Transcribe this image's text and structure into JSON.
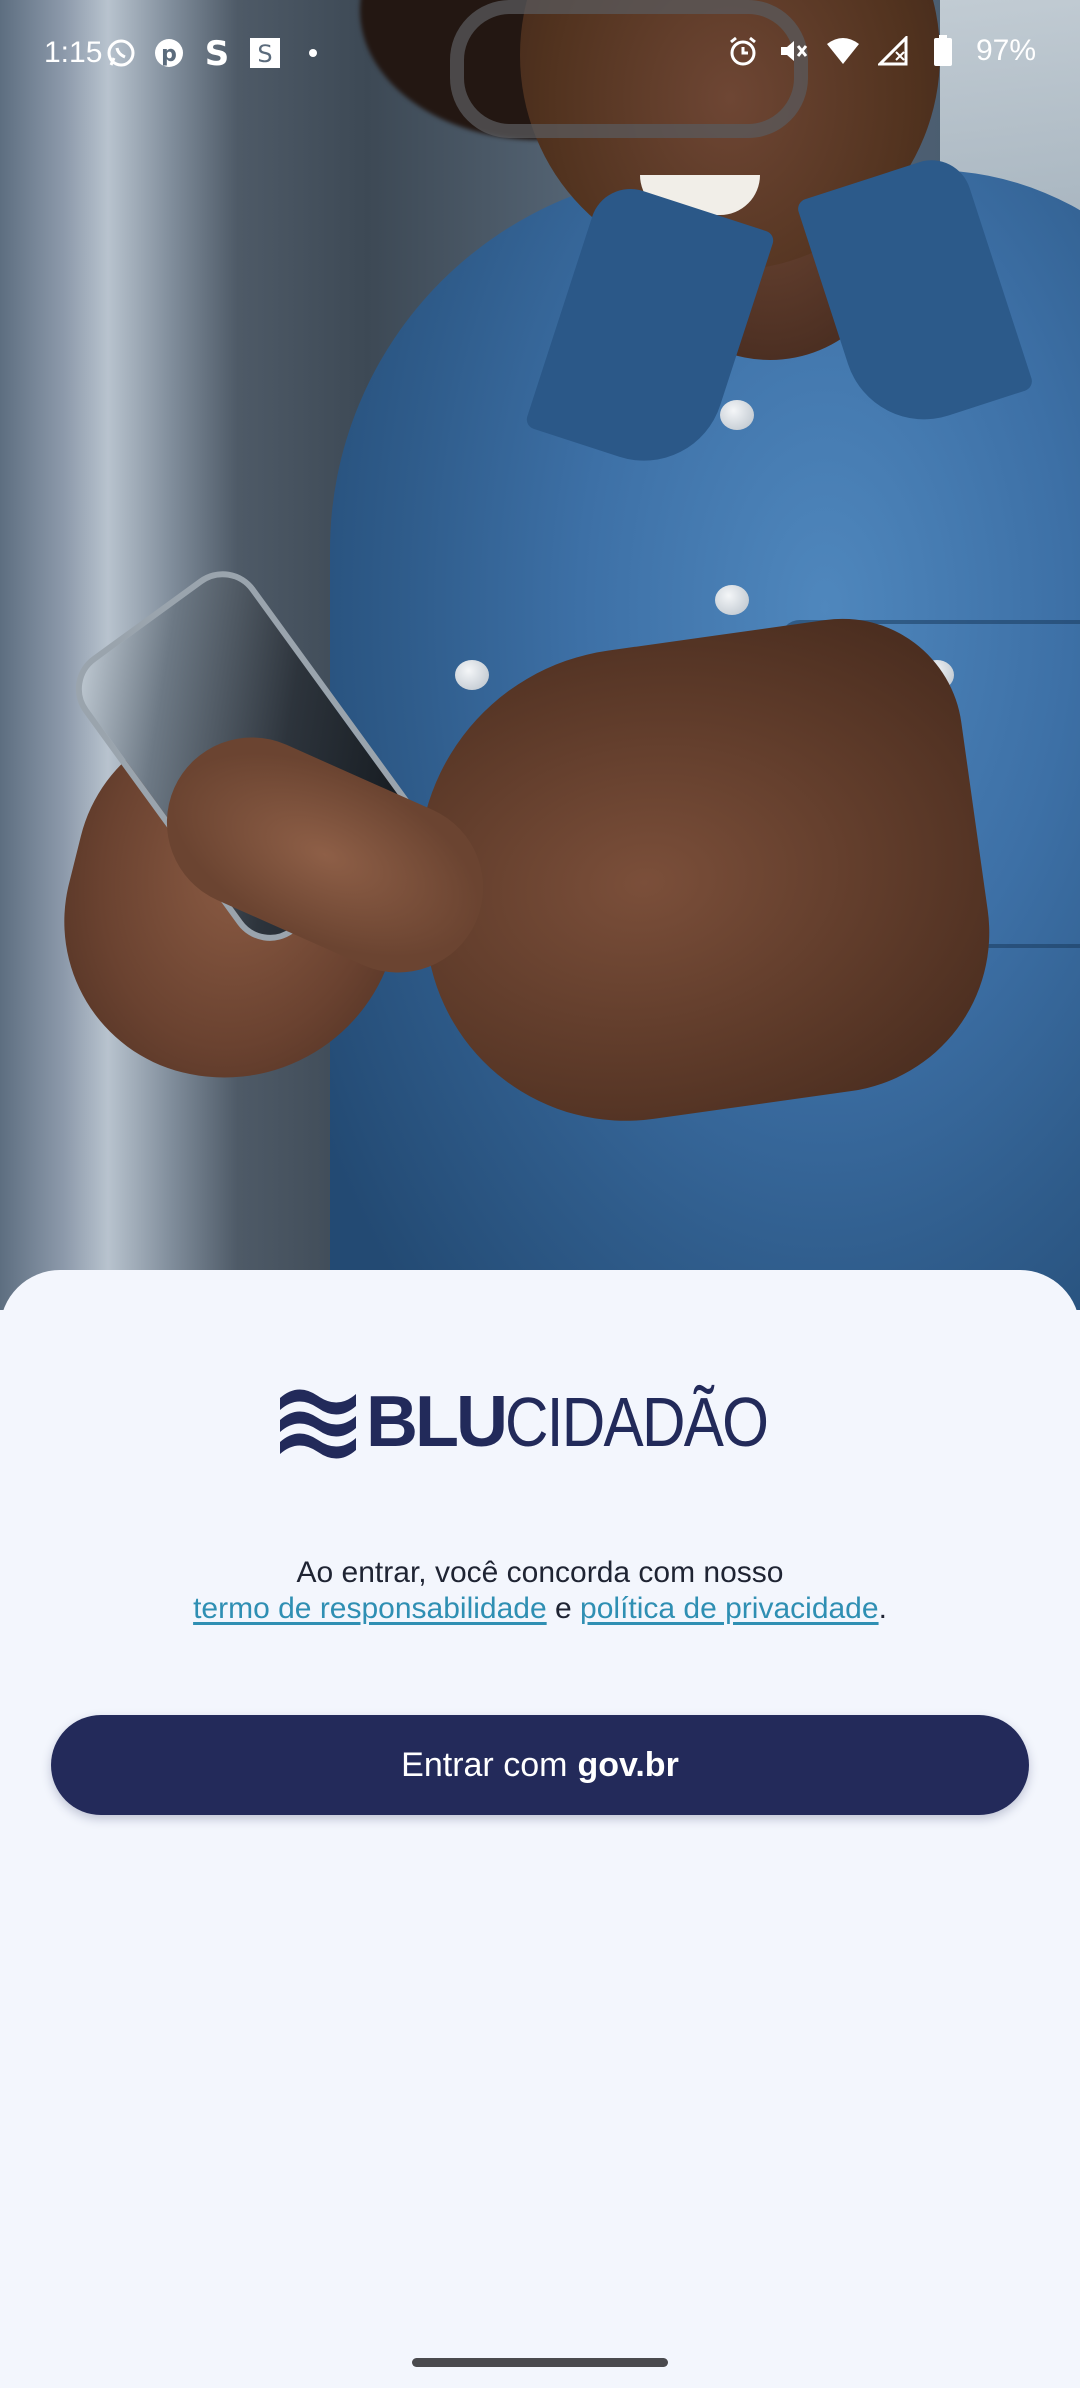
{
  "status_bar": {
    "time": "1:15",
    "notification_icons": [
      "whatsapp-icon",
      "pinterest-icon",
      "s-app-icon",
      "s-app-boxed-icon",
      "dot-icon"
    ],
    "system_icons": [
      "alarm-icon",
      "vibrate-off-icon",
      "wifi-icon",
      "signal-icon",
      "battery-icon"
    ],
    "battery": "97%"
  },
  "logo": {
    "bold": "BLU",
    "light": "CIDADÃO"
  },
  "terms": {
    "line1": "Ao entrar, você concorda com nosso",
    "link1": "termo de responsabilidade",
    "connector": "e",
    "link2": "política de privacidade",
    "end": "."
  },
  "login_button": {
    "prefix": "Entrar com",
    "brand": "gov.br"
  },
  "colors": {
    "brand_navy": "#232a5a",
    "link": "#2f8fb3",
    "sheet_bg": "#f3f6fd"
  }
}
